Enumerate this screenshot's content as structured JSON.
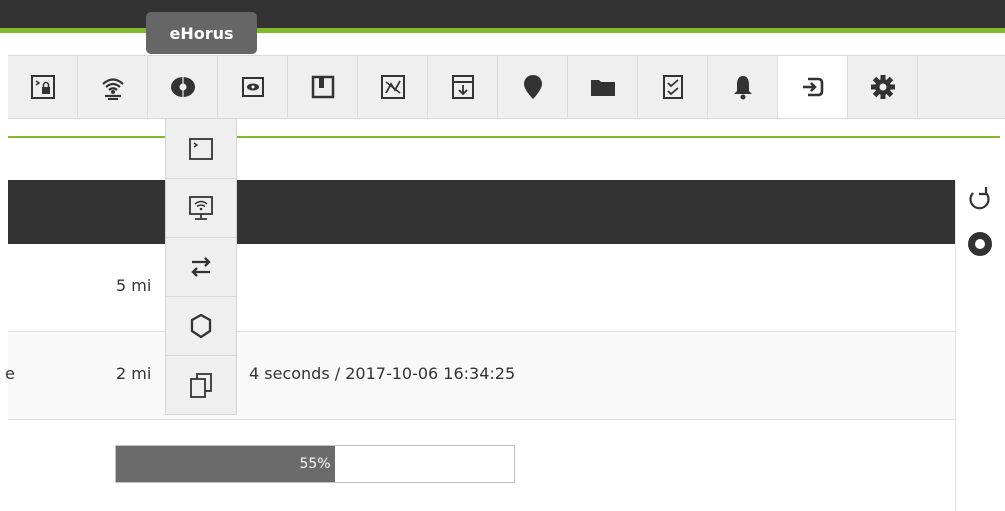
{
  "tooltip": {
    "text": "eHorus"
  },
  "toolbar": {
    "items": [
      {
        "name": "remote-lock-icon"
      },
      {
        "name": "network-icon"
      },
      {
        "name": "ehorus-icon"
      },
      {
        "name": "view-icon"
      },
      {
        "name": "module-icon"
      },
      {
        "name": "graph-icon"
      },
      {
        "name": "template-icon"
      },
      {
        "name": "gis-map-icon"
      },
      {
        "name": "folder-icon"
      },
      {
        "name": "checklist-icon"
      },
      {
        "name": "alert-bell-icon"
      },
      {
        "name": "login-icon"
      },
      {
        "name": "settings-gear-icon"
      }
    ]
  },
  "ehorus_menu": {
    "items": [
      {
        "name": "terminal-icon"
      },
      {
        "name": "remote-desktop-icon"
      },
      {
        "name": "transfer-icon"
      },
      {
        "name": "processes-icon"
      },
      {
        "name": "files-icon"
      }
    ]
  },
  "table": {
    "rows": [
      {
        "lead": "",
        "value": "5 mi"
      },
      {
        "lead": "e",
        "value": "2 mi",
        "value_tail": "4 seconds / 2017-10-06 16:34:25"
      },
      {
        "lead": "",
        "progress_label": "55%",
        "progress_value": 0.55
      }
    ]
  },
  "colors": {
    "accent": "#82b92e",
    "dark_bar": "#333333",
    "progress_fill": "#6b6b6b"
  }
}
